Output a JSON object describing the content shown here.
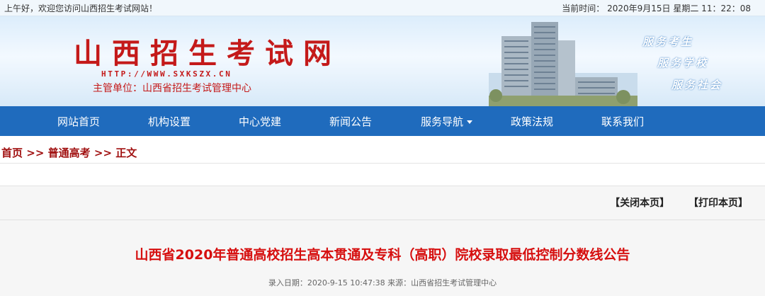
{
  "topbar": {
    "greeting": "上午好，欢迎您访问山西招生考试网站！",
    "time": "当前时间： 2020年9月15日 星期二 11：22：08"
  },
  "header": {
    "title": "山西招生考试网",
    "url": "HTTP://WWW.SXKSZX.CN",
    "org": "主管单位：山西省招生考试管理中心",
    "slogans": [
      "服务考生",
      "服务学校",
      "服务社会"
    ]
  },
  "nav": {
    "items": [
      "网站首页",
      "机构设置",
      "中心党建",
      "新闻公告",
      "服务导航",
      "政策法规",
      "联系我们"
    ]
  },
  "breadcrumb": {
    "home": "首页",
    "sep1": ">>",
    "section": "普通高考",
    "sep2": ">>",
    "current": "正文"
  },
  "article": {
    "close_label": "【关闭本页】",
    "print_label": "【打印本页】",
    "title": "山西省2020年普通高校招生高本贯通及专科（高职）院校录取最低控制分数线公告",
    "meta": "录入日期：2020-9-15 10:47:38 来源：山西省招生考试管理中心"
  },
  "colors": {
    "nav_bg": "#1f6bbd",
    "title_red": "#c41a1a",
    "article_title": "#d60f0f"
  }
}
